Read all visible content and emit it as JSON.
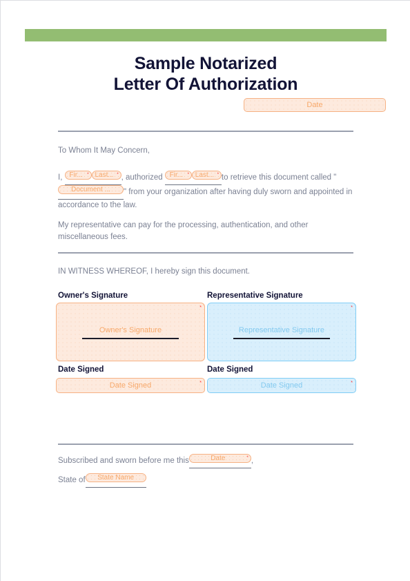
{
  "document": {
    "title_line1": "Sample Notarized",
    "title_line2": "Letter Of Authorization",
    "accent_green": "#93bd72",
    "title_color": "#121336",
    "body_color": "#7b8193",
    "orange_accent": "#f7a86a",
    "blue_accent": "#83c9ef",
    "required_marker": "*"
  },
  "header": {
    "date_field_placeholder": "Date"
  },
  "body": {
    "salutation": "To Whom It May Concern,",
    "main_prefix": "I,",
    "main_mid": ", authorized",
    "main_after_names": "to retrieve this document called \"",
    "main_after_document": "\" from your organization after having duly sworn and appointed in accordance to the law.",
    "fees_paragraph": "My representative can pay for the processing, authentication, and other miscellaneous fees.",
    "witness_paragraph": "IN WITNESS WHEREOF, I hereby sign this document.",
    "fields": {
      "owner_first_name": "Fir...",
      "owner_last_name": "Last...",
      "rep_first_name": "Fir...",
      "rep_last_name": "Last...",
      "document_name": "Document ..."
    }
  },
  "signatures": {
    "owner": {
      "label": "Owner's Signature",
      "field_placeholder": "Owner's Signature",
      "date_label": "Date Signed",
      "date_placeholder": "Date Signed"
    },
    "representative": {
      "label": "Representative Signature",
      "field_placeholder": "Representative Signature",
      "date_label": "Date Signed",
      "date_placeholder": "Date Signed"
    }
  },
  "notary": {
    "sworn_prefix": "Subscribed and sworn before me this",
    "sworn_suffix": ",",
    "date_placeholder": "Date",
    "state_prefix": "State of",
    "state_placeholder": "State Name"
  }
}
